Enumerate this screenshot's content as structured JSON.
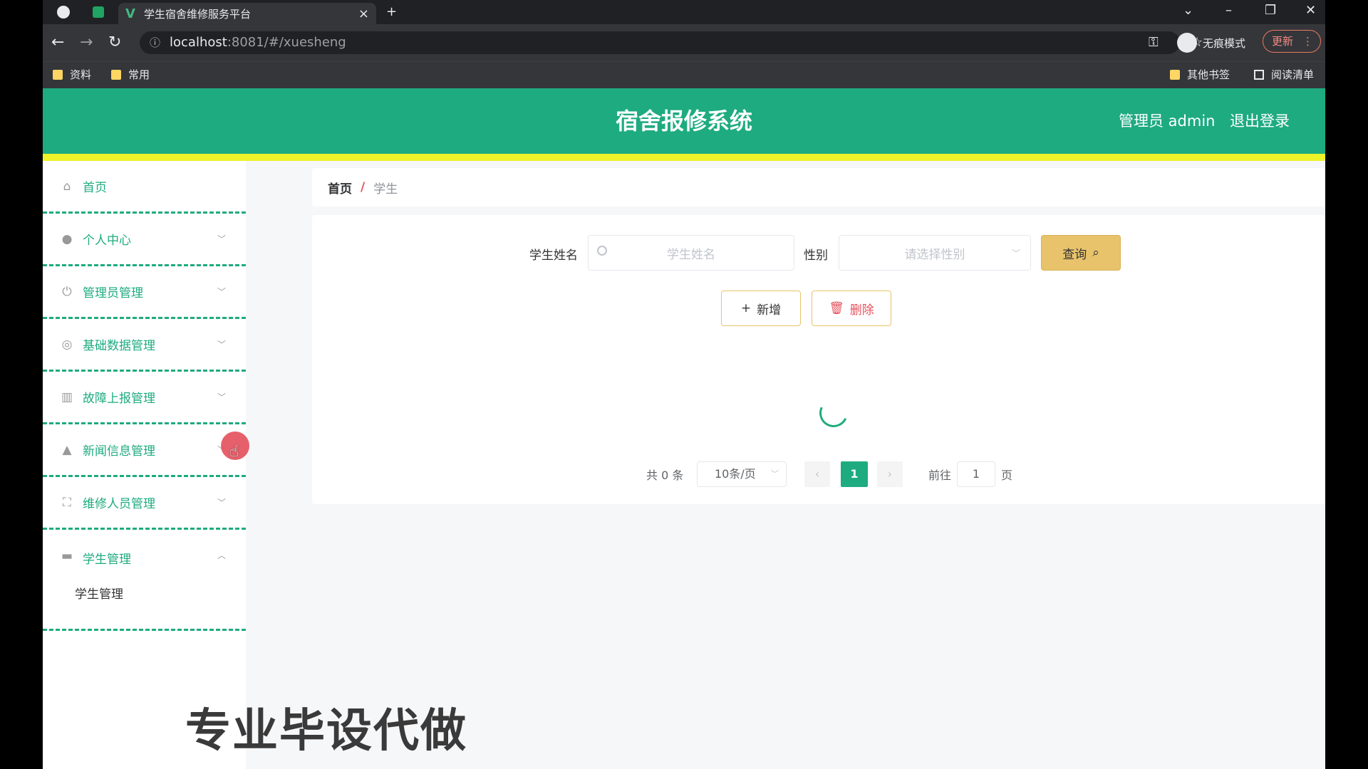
{
  "browser": {
    "tab_title": "学生宿舍维修服务平台",
    "tab_close": "×",
    "new_tab": "+",
    "url_host": "localhost",
    "url_rest": ":8081/#/xuesheng",
    "incognito_label": "无痕模式",
    "update_label": "更新",
    "bookmarks": [
      "资料",
      "常用"
    ],
    "other_bookmarks": "其他书签",
    "reading_list": "阅读清单"
  },
  "header": {
    "title": "宿舍报修系统",
    "admin_label": "管理员 admin",
    "logout_label": "退出登录"
  },
  "sidebar": {
    "items": [
      {
        "label": "首页",
        "icon": "home-icon"
      },
      {
        "label": "个人中心",
        "icon": "user-icon"
      },
      {
        "label": "管理员管理",
        "icon": "power-icon"
      },
      {
        "label": "基础数据管理",
        "icon": "settings-icon"
      },
      {
        "label": "故障上报管理",
        "icon": "chart-icon"
      },
      {
        "label": "新闻信息管理",
        "icon": "person-icon"
      },
      {
        "label": "维修人员管理",
        "icon": "fullscreen-icon"
      },
      {
        "label": "学生管理",
        "icon": "briefcase-icon"
      }
    ],
    "sub_item": "学生管理"
  },
  "breadcrumb": {
    "home": "首页",
    "sep": "/",
    "current": "学生"
  },
  "search": {
    "name_label": "学生姓名",
    "name_placeholder": "学生姓名",
    "gender_label": "性别",
    "gender_placeholder": "请选择性别",
    "query_label": "查询"
  },
  "actions": {
    "add_label": "新增",
    "delete_label": "删除"
  },
  "pagination": {
    "total": "共 0 条",
    "page_size": "10条/页",
    "current_page": "1",
    "goto_label": "前往",
    "goto_value": "1",
    "page_unit": "页"
  },
  "watermark": "专业毕设代做",
  "colors": {
    "primary": "#1eab7f",
    "accent": "#eef229",
    "query_button": "#e8c36c",
    "danger": "#e4525e"
  }
}
